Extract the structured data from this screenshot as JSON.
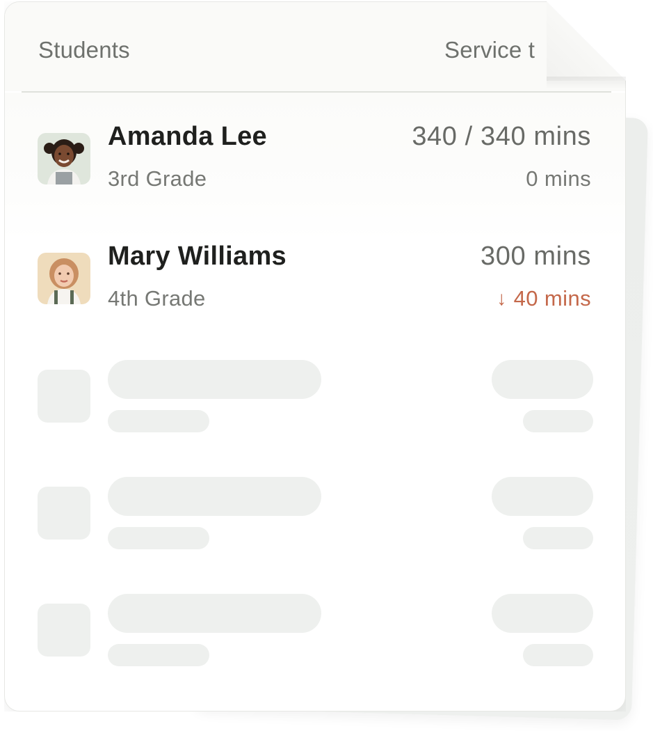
{
  "table": {
    "header": {
      "students_label": "Students",
      "service_label": "Service t"
    },
    "students": [
      {
        "name": "Amanda Lee",
        "grade": "3rd Grade",
        "total": "340 / 340 mins",
        "delta": "0 mins",
        "delta_direction": "none",
        "avatar_icon": "student-photo-icon"
      },
      {
        "name": "Mary Williams",
        "grade": "4th Grade",
        "total": "300 mins",
        "delta": "40 mins",
        "delta_direction": "down",
        "delta_arrow": "↓",
        "avatar_icon": "student-photo-icon"
      }
    ],
    "placeholder_rows": 3
  },
  "colors": {
    "text_primary": "#1f201e",
    "text_secondary": "#767874",
    "delta_negative": "#c4684a",
    "skeleton": "#eef0ee"
  }
}
